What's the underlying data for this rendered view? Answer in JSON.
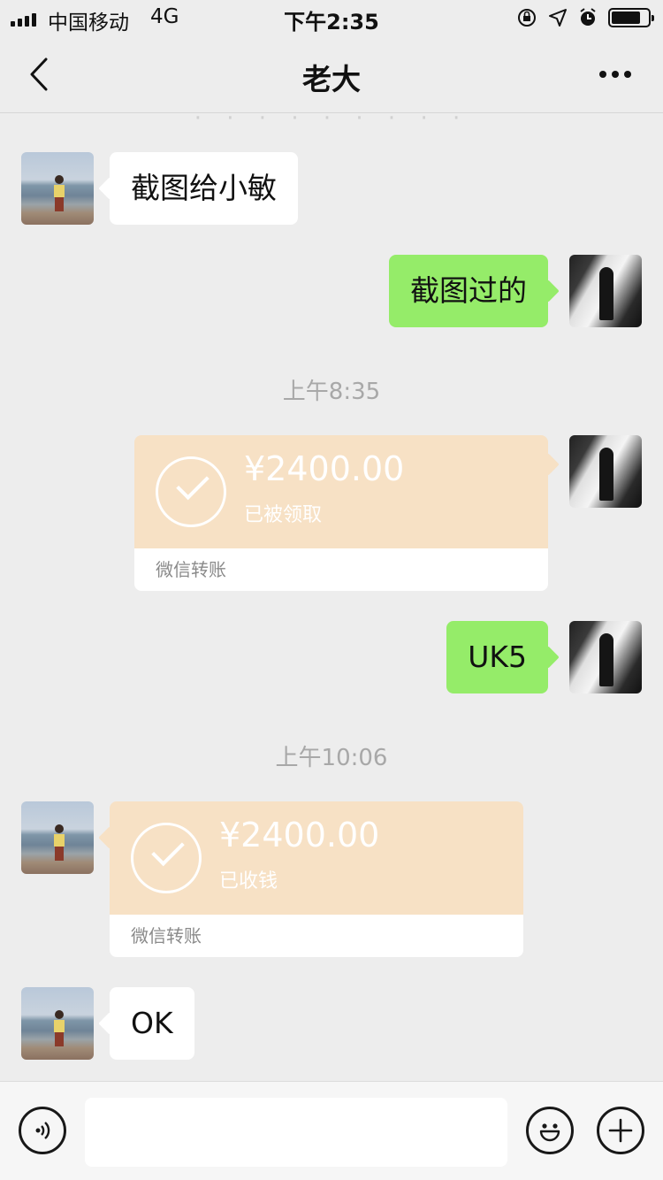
{
  "status_bar": {
    "carrier": "中国移动",
    "network": "4G",
    "time": "下午2:35",
    "battery_level": 0.8
  },
  "nav": {
    "title": "老大",
    "back_icon": "chevron-left-icon",
    "more_icon": "more-dots-icon"
  },
  "chat": {
    "faded_top_text": "· · · · · · · · ·",
    "messages": [
      {
        "side": "left",
        "type": "text",
        "text": "截图给小敏"
      },
      {
        "side": "right",
        "type": "text",
        "text": "截图过的"
      },
      {
        "type": "time",
        "text": "上午8:35"
      },
      {
        "side": "right",
        "type": "transfer",
        "amount": "¥2400.00",
        "status": "已被领取",
        "footer": "微信转账"
      },
      {
        "side": "right",
        "type": "text",
        "text": "UK5"
      },
      {
        "type": "time",
        "text": "上午10:06"
      },
      {
        "side": "left",
        "type": "transfer",
        "amount": "¥2400.00",
        "status": "已收钱",
        "footer": "微信转账"
      },
      {
        "side": "left",
        "type": "text",
        "text": "OK"
      }
    ]
  },
  "input_bar": {
    "voice_icon": "voice-icon",
    "emoji_icon": "emoji-icon",
    "plus_icon": "plus-icon",
    "text_value": ""
  },
  "colors": {
    "background": "#ededed",
    "sent_bubble": "#95ec69",
    "received_bubble": "#ffffff",
    "transfer_card": "#f7e1c5"
  }
}
